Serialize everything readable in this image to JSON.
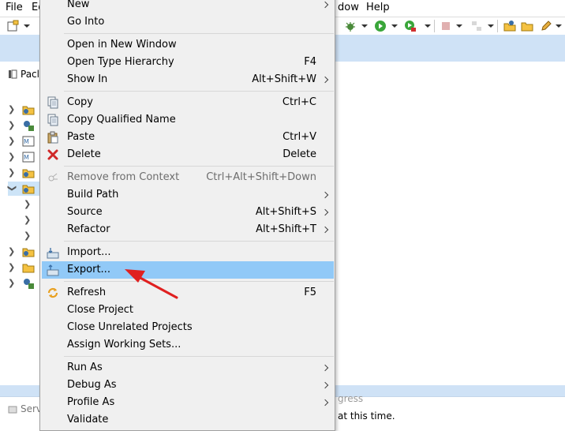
{
  "menubar": {
    "file": "File",
    "edit": "Ed",
    "window": "dow",
    "help": "Help"
  },
  "left_panel": {
    "tab_label": "Pacl"
  },
  "bottom_panel": {
    "tab_label": "Serv",
    "progress_label": "gress",
    "progress_message": "at this time."
  },
  "context_menu": {
    "items": {
      "new": {
        "label": "New",
        "has_submenu": true
      },
      "go_into": {
        "label": "Go Into"
      },
      "open_new_window": {
        "label": "Open in New Window"
      },
      "open_type_hierarchy": {
        "label": "Open Type Hierarchy",
        "shortcut": "F4"
      },
      "show_in": {
        "label": "Show In",
        "shortcut": "Alt+Shift+W",
        "has_submenu": true
      },
      "copy": {
        "label": "Copy",
        "shortcut": "Ctrl+C",
        "icon": "copy-icon"
      },
      "copy_qualified": {
        "label": "Copy Qualified Name",
        "icon": "copy-qualified-icon"
      },
      "paste": {
        "label": "Paste",
        "shortcut": "Ctrl+V",
        "icon": "paste-icon"
      },
      "delete": {
        "label": "Delete",
        "shortcut": "Delete",
        "icon": "delete-icon"
      },
      "remove_context": {
        "label": "Remove from Context",
        "shortcut": "Ctrl+Alt+Shift+Down",
        "disabled": true,
        "icon": "remove-context-icon"
      },
      "build_path": {
        "label": "Build Path",
        "has_submenu": true
      },
      "source": {
        "label": "Source",
        "shortcut": "Alt+Shift+S",
        "has_submenu": true
      },
      "refactor": {
        "label": "Refactor",
        "shortcut": "Alt+Shift+T",
        "has_submenu": true
      },
      "import": {
        "label": "Import...",
        "icon": "import-icon"
      },
      "export": {
        "label": "Export...",
        "icon": "export-icon",
        "highlighted": true
      },
      "refresh": {
        "label": "Refresh",
        "shortcut": "F5",
        "icon": "refresh-icon"
      },
      "close_project": {
        "label": "Close Project"
      },
      "close_unrelated": {
        "label": "Close Unrelated Projects"
      },
      "assign_working_sets": {
        "label": "Assign Working Sets..."
      },
      "run_as": {
        "label": "Run As",
        "has_submenu": true
      },
      "debug_as": {
        "label": "Debug As",
        "has_submenu": true
      },
      "profile_as": {
        "label": "Profile As",
        "has_submenu": true
      },
      "validate": {
        "label": "Validate"
      }
    }
  },
  "colors": {
    "highlight": "#91c9f7",
    "menu_bg": "#f0f0f0",
    "annotation_arrow": "#e02020",
    "workbench_band": "#cfe2f6"
  }
}
